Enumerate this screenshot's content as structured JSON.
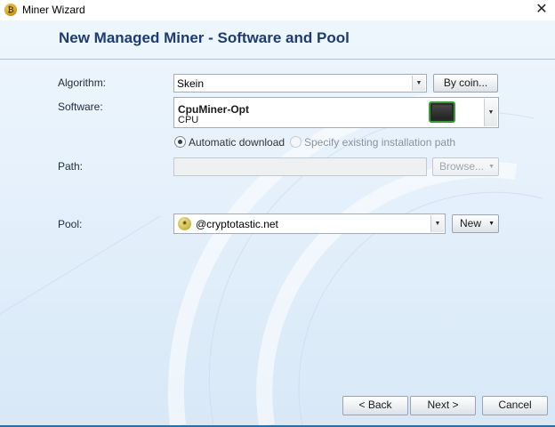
{
  "window": {
    "title": "Miner Wizard",
    "close_glyph": "✕",
    "icon": "bitcoin-coin-icon"
  },
  "header": {
    "title": "New Managed Miner - Software and Pool"
  },
  "form": {
    "algorithm": {
      "label": "Algorithm:",
      "value": "Skein",
      "by_coin_label": "By coin..."
    },
    "software": {
      "label": "Software:",
      "name": "CpuMiner-Opt",
      "device": "CPU",
      "icon": "cpu-chip-icon"
    },
    "install": {
      "automatic_label": "Automatic download",
      "specify_label": "Specify existing installation path",
      "selected": "automatic"
    },
    "path": {
      "label": "Path:",
      "value": "",
      "browse_label": "Browse..."
    },
    "pool": {
      "label": "Pool:",
      "value": "@cryptotastic.net",
      "new_label": "New",
      "icon": "pool-coin-icon"
    }
  },
  "footer": {
    "back_label": "< Back",
    "next_label": "Next >",
    "cancel_label": "Cancel"
  },
  "colors": {
    "header_title": "#1d3c74",
    "background": "#e4f0fb"
  }
}
